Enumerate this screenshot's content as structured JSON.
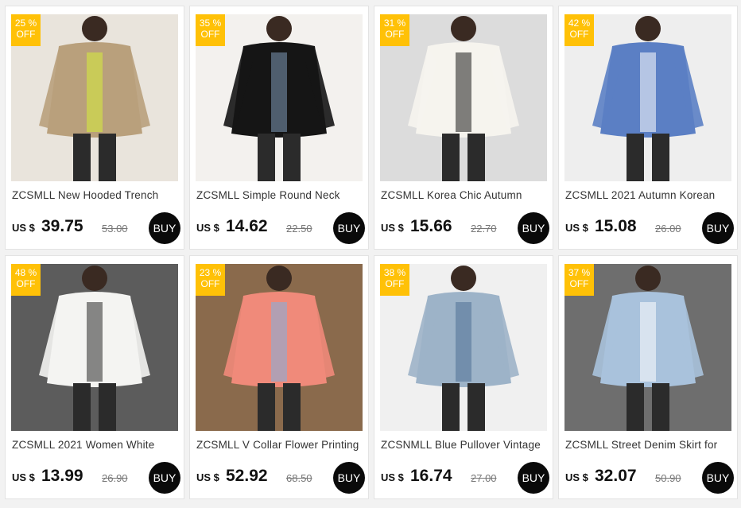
{
  "products": [
    {
      "title": "ZCSMLL New Hooded Trench",
      "discount_pct": "25 %",
      "discount_label": "OFF",
      "currency": "US $",
      "price": "39.75",
      "old_price": "53.00",
      "buy_label": "BUY",
      "photo_icon": "woman-trench-coat-photo",
      "colors": {
        "bg": "#e9e4dc",
        "garment": "#b9a07c",
        "accent": "#d7ee3a"
      }
    },
    {
      "title": "ZCSMLL Simple Round Neck",
      "discount_pct": "35 %",
      "discount_label": "OFF",
      "currency": "US $",
      "price": "14.62",
      "old_price": "22.50",
      "buy_label": "BUY",
      "photo_icon": "woman-black-tshirt-photo",
      "colors": {
        "bg": "#f3f1ee",
        "garment": "#151515",
        "accent": "#7f9ab8"
      }
    },
    {
      "title": "ZCSMLL Korea Chic Autumn",
      "discount_pct": "31 %",
      "discount_label": "OFF",
      "currency": "US $",
      "price": "15.66",
      "old_price": "22.70",
      "buy_label": "BUY",
      "photo_icon": "woman-white-blouse-photo",
      "colors": {
        "bg": "#dcdcdc",
        "garment": "#f6f4ee",
        "accent": "#1b1b1b"
      }
    },
    {
      "title": "ZCSMLL 2021 Autumn Korean",
      "discount_pct": "42 %",
      "discount_label": "OFF",
      "currency": "US $",
      "price": "15.08",
      "old_price": "26.00",
      "buy_label": "BUY",
      "photo_icon": "plaid-shirt-photo",
      "colors": {
        "bg": "#eeeeee",
        "garment": "#5b7fc4",
        "accent": "#ffffff"
      }
    },
    {
      "title": "ZCSMLL 2021 Women White",
      "discount_pct": "48 %",
      "discount_label": "OFF",
      "currency": "US $",
      "price": "13.99",
      "old_price": "26.90",
      "buy_label": "BUY",
      "photo_icon": "white-dress-photo",
      "colors": {
        "bg": "#5c5c5c",
        "garment": "#f4f4f2",
        "accent": "#2a2a2a"
      }
    },
    {
      "title": "ZCSMLL V Collar Flower Printing",
      "discount_pct": "23 %",
      "discount_label": "OFF",
      "currency": "US $",
      "price": "52.92",
      "old_price": "68.50",
      "buy_label": "BUY",
      "photo_icon": "flower-cardigan-photo",
      "colors": {
        "bg": "#8a6a4c",
        "garment": "#f08a7a",
        "accent": "#7fb0e0"
      }
    },
    {
      "title": "ZCSNMLL Blue Pullover Vintage",
      "discount_pct": "38 %",
      "discount_label": "OFF",
      "currency": "US $",
      "price": "16.74",
      "old_price": "27.00",
      "buy_label": "BUY",
      "photo_icon": "blue-pullover-photo",
      "colors": {
        "bg": "#f0f0f0",
        "garment": "#9db3c8",
        "accent": "#4f6f95"
      }
    },
    {
      "title": "ZCSMLL Street Denim Skirt for",
      "discount_pct": "37 %",
      "discount_label": "OFF",
      "currency": "US $",
      "price": "32.07",
      "old_price": "50.90",
      "buy_label": "BUY",
      "photo_icon": "denim-skirt-photo",
      "colors": {
        "bg": "#6e6e6e",
        "garment": "#a9c2dc",
        "accent": "#ffffff"
      }
    }
  ]
}
